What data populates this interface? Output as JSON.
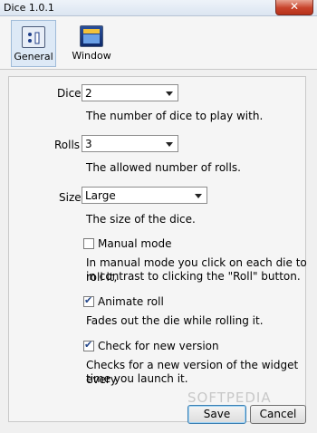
{
  "window": {
    "title": "Dice 1.0.1",
    "close_glyph": "✕"
  },
  "toolbar": {
    "items": [
      {
        "label": "General",
        "icon": "general-settings-icon"
      },
      {
        "label": "Window",
        "icon": "window-icon"
      }
    ]
  },
  "dice": {
    "label": "Dice",
    "value": "2",
    "help": "The number of dice to play with."
  },
  "rolls": {
    "label": "Rolls",
    "value": "3",
    "help": "The allowed number of rolls."
  },
  "size": {
    "label": "Size",
    "value": "Large",
    "help": "The size of the dice."
  },
  "manual_mode": {
    "label": "Manual mode",
    "checked": false,
    "help_line1": "In manual mode you click on each die to roll it,",
    "help_line2": "in contrast to clicking the \"Roll\" button."
  },
  "animate_roll": {
    "label": "Animate roll",
    "checked": true,
    "help": "Fades out the die while rolling it."
  },
  "check_version": {
    "label": "Check for new version",
    "checked": true,
    "help_line1": "Checks for a new version of the widget every",
    "help_line2": "time you launch it."
  },
  "buttons": {
    "save": "Save",
    "cancel": "Cancel"
  },
  "watermark": "SOFTPEDIA"
}
